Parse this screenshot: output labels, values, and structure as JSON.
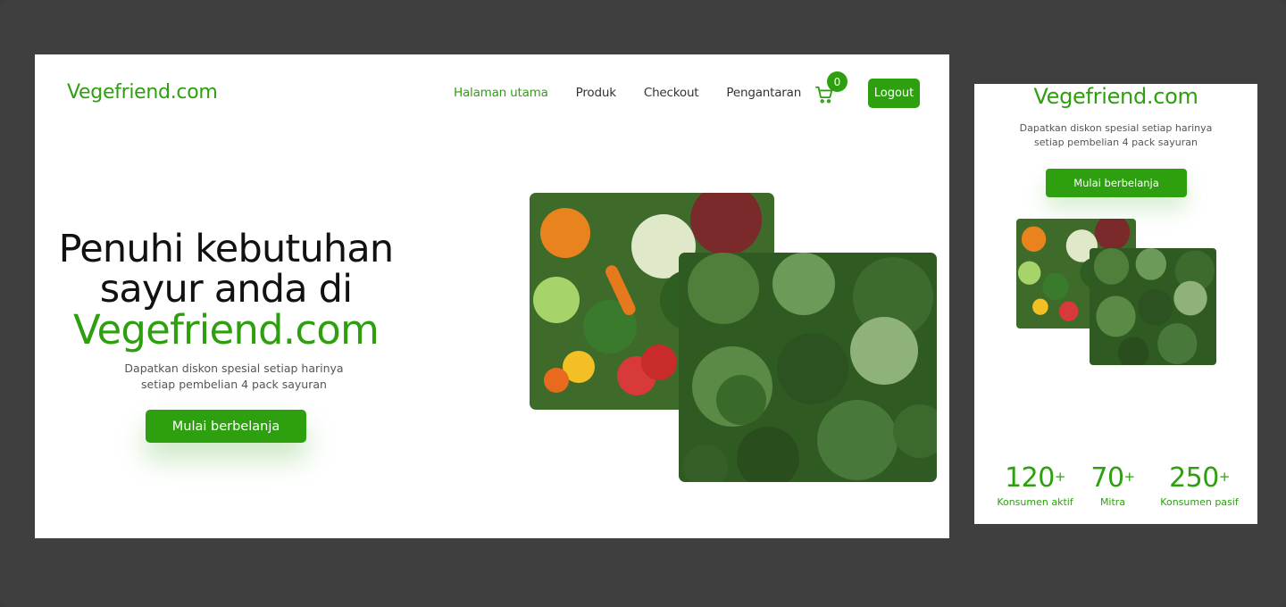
{
  "desktop": {
    "logo": "Vegefriend.com",
    "nav": [
      {
        "label": "Halaman utama",
        "active": true
      },
      {
        "label": "Produk",
        "active": false
      },
      {
        "label": "Checkout",
        "active": false
      },
      {
        "label": "Pengantaran",
        "active": false
      }
    ],
    "cart_count": "0",
    "logout_label": "Logout",
    "hero": {
      "title_line1": "Penuhi kebutuhan",
      "title_line2": "sayur anda di",
      "title_brand": "Vegefriend.com",
      "subtitle_line1": "Dapatkan diskon spesial setiap harinya",
      "subtitle_line2": "setiap pembelian 4 pack sayuran",
      "cta_label": "Mulai berbelanja"
    }
  },
  "mobile": {
    "logo": "Vegefriend.com",
    "subtitle_line1": "Dapatkan diskon spesial setiap harinya",
    "subtitle_line2": "setiap pembelian 4 pack sayuran",
    "cta_label": "Mulai berbelanja",
    "stats": [
      {
        "value": "120",
        "suffix": "+",
        "label": "Konsumen aktif"
      },
      {
        "value": "70",
        "suffix": "+",
        "label": "Mitra"
      },
      {
        "value": "250",
        "suffix": "+",
        "label": "Konsumen pasif"
      }
    ]
  },
  "colors": {
    "brand_green": "#2ea00f",
    "background": "#3f3f3f",
    "text_dark": "#111111"
  },
  "icons": {
    "cart": "shopping-cart-icon"
  }
}
